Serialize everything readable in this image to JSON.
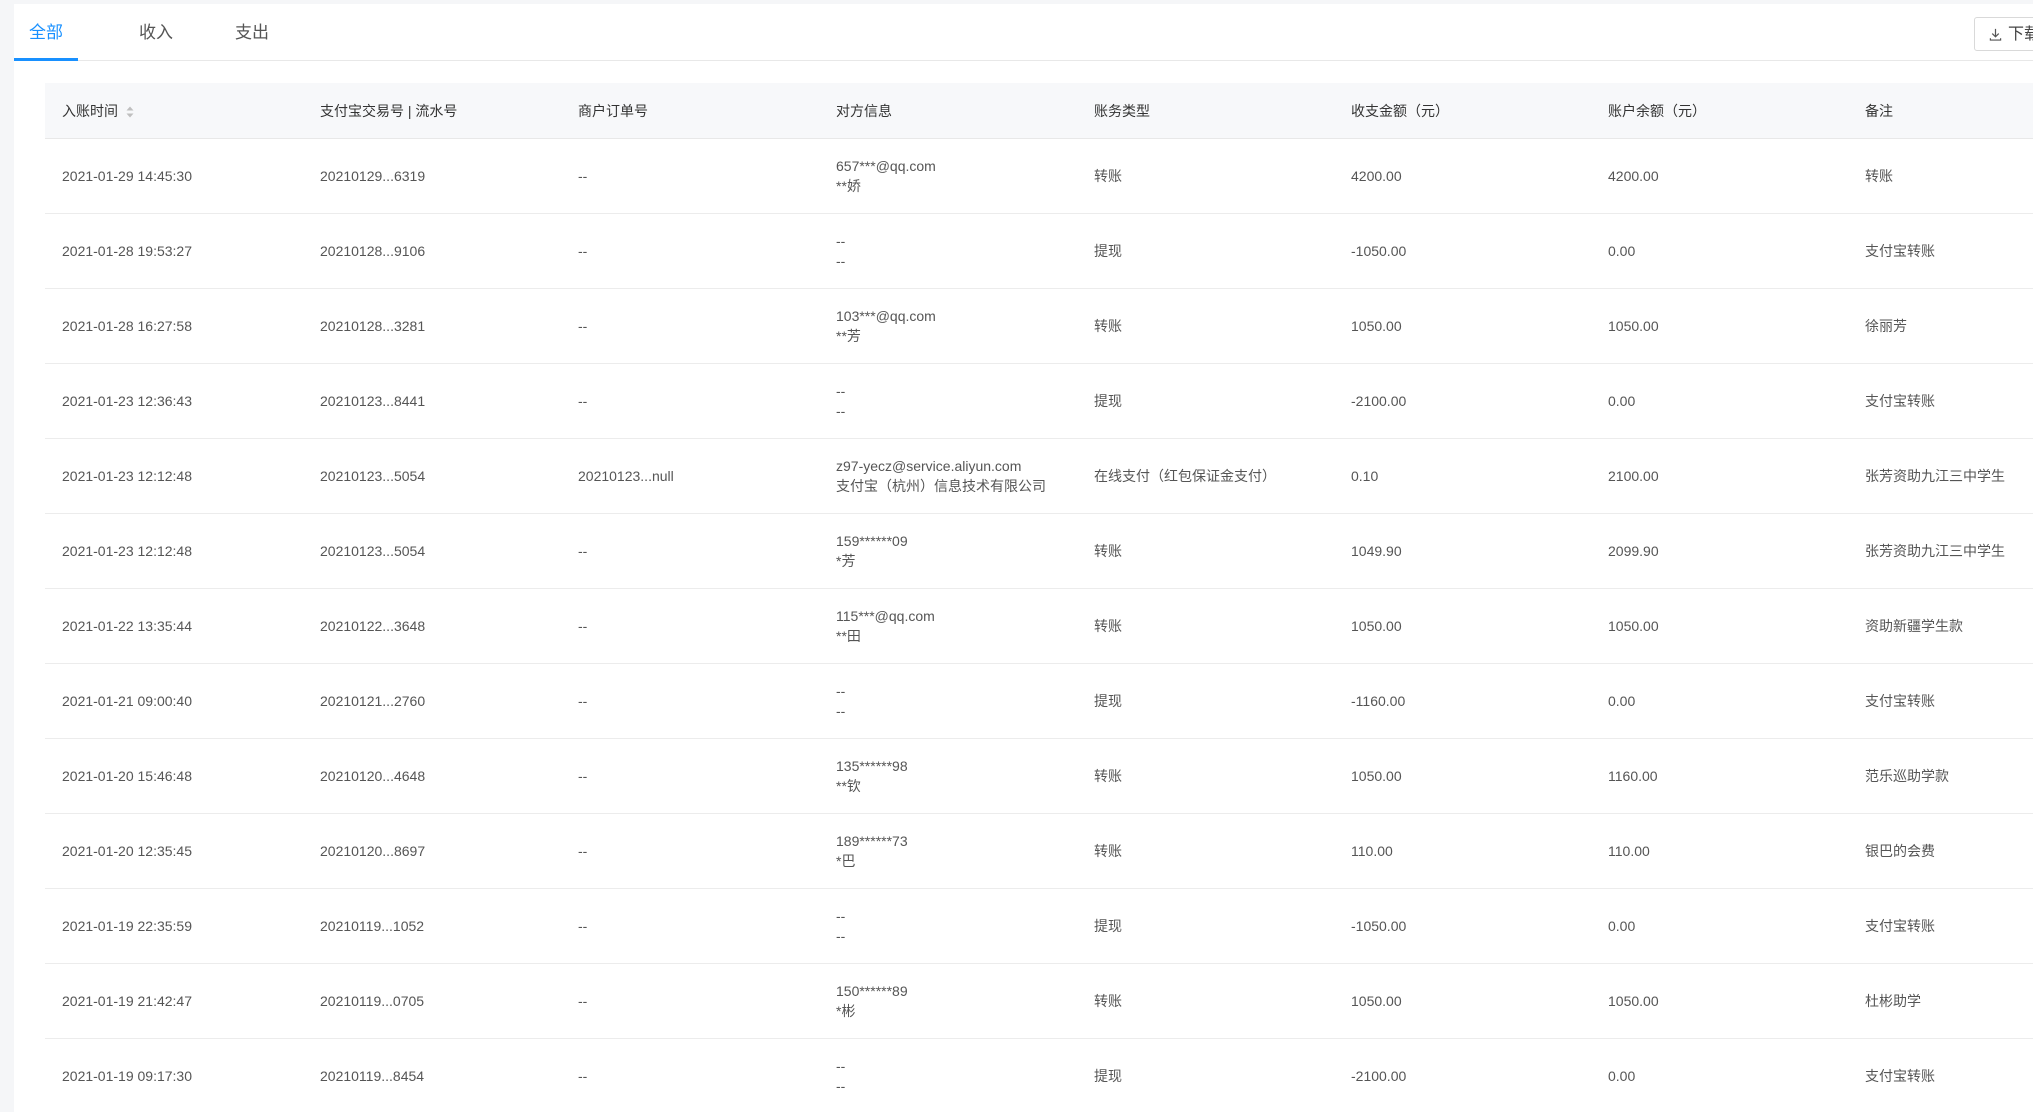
{
  "tabs": [
    {
      "label": "全部"
    },
    {
      "label": "收入"
    },
    {
      "label": "支出"
    }
  ],
  "toolbar": {
    "download_label": "下载",
    "download_icon": "download-icon"
  },
  "table": {
    "headers": [
      "入账时间",
      "支付宝交易号 | 流水号",
      "商户订单号",
      "对方信息",
      "账务类型",
      "收支金额（元）",
      "账户余额（元）",
      "备注"
    ],
    "rows": [
      {
        "time": "2021-01-29 14:45:30",
        "trade_no": "20210129...6319",
        "order_no": "--",
        "counterparty_1": "657***@qq.com",
        "counterparty_2": "**娇",
        "type": "转账",
        "amount": "4200.00",
        "balance": "4200.00",
        "note": "转账"
      },
      {
        "time": "2021-01-28 19:53:27",
        "trade_no": "20210128...9106",
        "order_no": "--",
        "counterparty_1": "--",
        "counterparty_2": "--",
        "type": "提现",
        "amount": "-1050.00",
        "balance": "0.00",
        "note": "支付宝转账"
      },
      {
        "time": "2021-01-28 16:27:58",
        "trade_no": "20210128...3281",
        "order_no": "--",
        "counterparty_1": "103***@qq.com",
        "counterparty_2": "**芳",
        "type": "转账",
        "amount": "1050.00",
        "balance": "1050.00",
        "note": "徐丽芳"
      },
      {
        "time": "2021-01-23 12:36:43",
        "trade_no": "20210123...8441",
        "order_no": "--",
        "counterparty_1": "--",
        "counterparty_2": "--",
        "type": "提现",
        "amount": "-2100.00",
        "balance": "0.00",
        "note": "支付宝转账"
      },
      {
        "time": "2021-01-23 12:12:48",
        "trade_no": "20210123...5054",
        "order_no": "20210123...null",
        "counterparty_1": "z97-yecz@service.aliyun.com",
        "counterparty_2": "支付宝（杭州）信息技术有限公司",
        "type": "在线支付（红包保证金支付）",
        "amount": "0.10",
        "balance": "2100.00",
        "note": "张芳资助九江三中学生"
      },
      {
        "time": "2021-01-23 12:12:48",
        "trade_no": "20210123...5054",
        "order_no": "--",
        "counterparty_1": "159******09",
        "counterparty_2": "*芳",
        "type": "转账",
        "amount": "1049.90",
        "balance": "2099.90",
        "note": "张芳资助九江三中学生"
      },
      {
        "time": "2021-01-22 13:35:44",
        "trade_no": "20210122...3648",
        "order_no": "--",
        "counterparty_1": "115***@qq.com",
        "counterparty_2": "**田",
        "type": "转账",
        "amount": "1050.00",
        "balance": "1050.00",
        "note": "资助新疆学生款"
      },
      {
        "time": "2021-01-21 09:00:40",
        "trade_no": "20210121...2760",
        "order_no": "--",
        "counterparty_1": "--",
        "counterparty_2": "--",
        "type": "提现",
        "amount": "-1160.00",
        "balance": "0.00",
        "note": "支付宝转账"
      },
      {
        "time": "2021-01-20 15:46:48",
        "trade_no": "20210120...4648",
        "order_no": "--",
        "counterparty_1": "135******98",
        "counterparty_2": "**钦",
        "type": "转账",
        "amount": "1050.00",
        "balance": "1160.00",
        "note": "范乐巡助学款"
      },
      {
        "time": "2021-01-20 12:35:45",
        "trade_no": "20210120...8697",
        "order_no": "--",
        "counterparty_1": "189******73",
        "counterparty_2": "*巴",
        "type": "转账",
        "amount": "110.00",
        "balance": "110.00",
        "note": "银巴的会费"
      },
      {
        "time": "2021-01-19 22:35:59",
        "trade_no": "20210119...1052",
        "order_no": "--",
        "counterparty_1": "--",
        "counterparty_2": "--",
        "type": "提现",
        "amount": "-1050.00",
        "balance": "0.00",
        "note": "支付宝转账"
      },
      {
        "time": "2021-01-19 21:42:47",
        "trade_no": "20210119...0705",
        "order_no": "--",
        "counterparty_1": "150******89",
        "counterparty_2": "*彬",
        "type": "转账",
        "amount": "1050.00",
        "balance": "1050.00",
        "note": "杜彬助学"
      },
      {
        "time": "2021-01-19 09:17:30",
        "trade_no": "20210119...8454",
        "order_no": "--",
        "counterparty_1": "--",
        "counterparty_2": "--",
        "type": "提现",
        "amount": "-2100.00",
        "balance": "0.00",
        "note": "支付宝转账"
      }
    ]
  },
  "colors": {
    "accent": "#1890ff",
    "header_bg": "#f7f8fa",
    "page_bg": "#f5f6f8"
  }
}
